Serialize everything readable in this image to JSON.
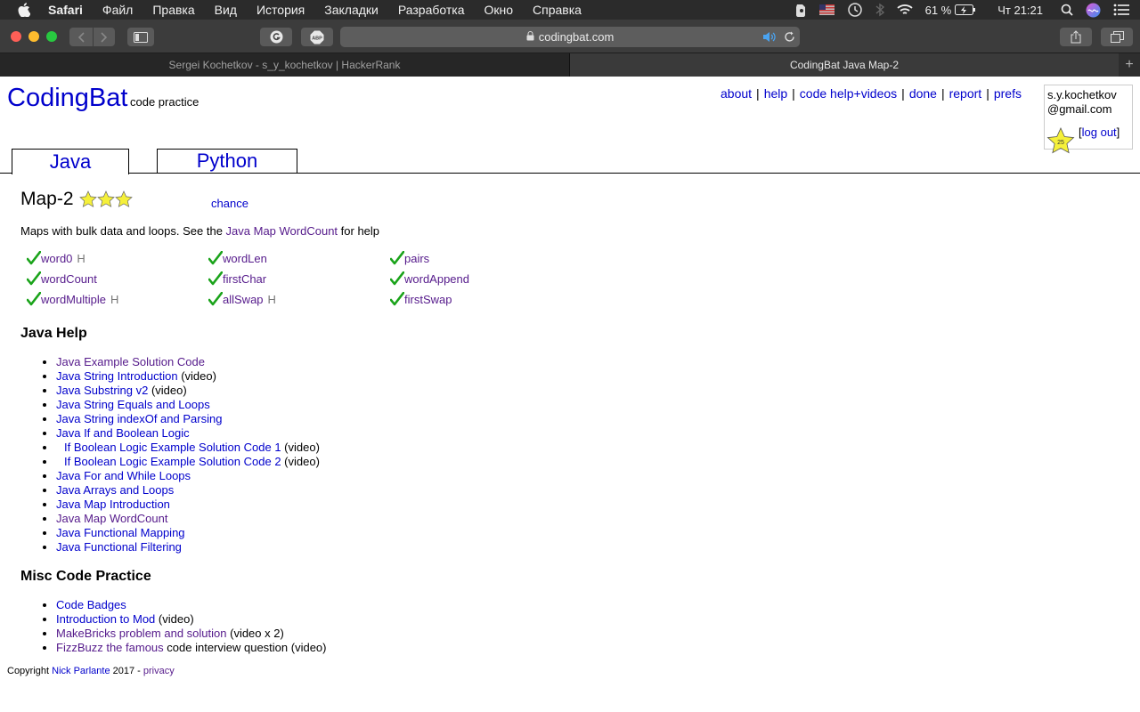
{
  "menubar": {
    "app": "Safari",
    "items": [
      "Файл",
      "Правка",
      "Вид",
      "История",
      "Закладки",
      "Разработка",
      "Окно",
      "Справка"
    ],
    "battery": "61 %",
    "clock": "Чт 21:21"
  },
  "browser": {
    "url": "codingbat.com",
    "tabs": [
      "Sergei Kochetkov - s_y_kochetkov | HackerRank",
      "CodingBat Java Map-2"
    ],
    "active_tab": 1
  },
  "site": {
    "logo": "CodingBat",
    "tagline": "code practice",
    "nav": [
      "about",
      "help",
      "code help+videos",
      "done",
      "report",
      "prefs"
    ],
    "user_line1": "s.y.kochetkov",
    "user_line2": "@gmail.com",
    "badge_count": "25",
    "logout": "log out",
    "lang_tabs": [
      "Java",
      "Python"
    ]
  },
  "main": {
    "title": "Map-2",
    "chance": "chance",
    "desc_pre": "Maps with bulk data and loops. See the ",
    "desc_link": "Java Map WordCount",
    "desc_post": " for help",
    "problems": [
      {
        "name": "word0",
        "hint": "H"
      },
      {
        "name": "wordLen",
        "hint": ""
      },
      {
        "name": "pairs",
        "hint": ""
      },
      {
        "name": "wordCount",
        "hint": ""
      },
      {
        "name": "firstChar",
        "hint": ""
      },
      {
        "name": "wordAppend",
        "hint": ""
      },
      {
        "name": "wordMultiple",
        "hint": "H"
      },
      {
        "name": "allSwap",
        "hint": "H"
      },
      {
        "name": "firstSwap",
        "hint": ""
      }
    ]
  },
  "java_help": {
    "heading": "Java Help",
    "items": [
      {
        "link": "Java Example Solution Code",
        "note": ""
      },
      {
        "link": "Java String Introduction",
        "note": "(video)"
      },
      {
        "link": "Java Substring v2",
        "note": "(video)"
      },
      {
        "link": "Java String Equals and Loops",
        "note": ""
      },
      {
        "link": "Java String indexOf and Parsing",
        "note": ""
      },
      {
        "link": "Java If and Boolean Logic",
        "note": ""
      },
      {
        "link": "If Boolean Logic Example Solution Code 1",
        "note": "(video)"
      },
      {
        "link": "If Boolean Logic Example Solution Code 2",
        "note": "(video)"
      },
      {
        "link": "Java For and While Loops",
        "note": ""
      },
      {
        "link": "Java Arrays and Loops",
        "note": ""
      },
      {
        "link": "Java Map Introduction",
        "note": ""
      },
      {
        "link": "Java Map WordCount",
        "note": ""
      },
      {
        "link": "Java Functional Mapping",
        "note": ""
      },
      {
        "link": "Java Functional Filtering",
        "note": ""
      }
    ]
  },
  "misc": {
    "heading": "Misc Code Practice",
    "items": [
      {
        "link": "Code Badges",
        "note": ""
      },
      {
        "link": "Introduction to Mod",
        "note": "(video)"
      },
      {
        "link": "MakeBricks problem and solution",
        "note": "(video x 2)"
      },
      {
        "link": "FizzBuzz the famous",
        "note": "code interview question (video)"
      }
    ]
  },
  "footer": {
    "pre": "Copyright ",
    "author": "Nick Parlante",
    "mid": " 2017 - ",
    "privacy": "privacy"
  }
}
